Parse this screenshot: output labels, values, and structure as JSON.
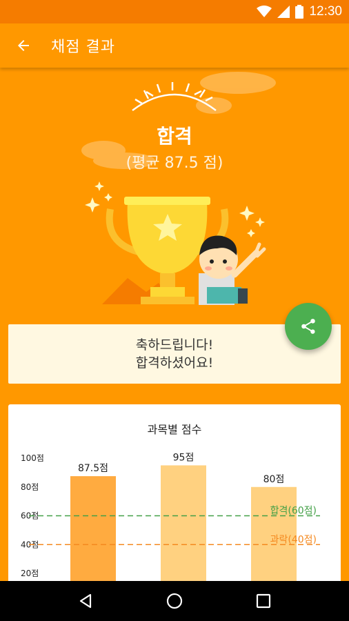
{
  "status_bar": {
    "time": "12:30"
  },
  "app_bar": {
    "title": "채점 결과"
  },
  "result": {
    "status": "합격",
    "average": "(평균 87.5 점)"
  },
  "congrats": {
    "line1": "축하드립니다!",
    "line2": "합격하셨어요!"
  },
  "icons": {
    "back": "arrow-back-icon",
    "share": "share-icon",
    "nav_back": "triangle-back-icon",
    "nav_home": "circle-home-icon",
    "nav_recent": "square-recents-icon"
  },
  "colors": {
    "primary": "#FF9800",
    "status_bar": "#F57C00",
    "fab": "#4CAF50",
    "pass_line": "#43A047",
    "fail_line": "#F4891F",
    "bar_first": "#FFAB40",
    "bar_other": "#FFD180"
  },
  "chart_data": {
    "type": "bar",
    "title": "과목별 점수",
    "categories": [
      "",
      "",
      ""
    ],
    "values": [
      87.5,
      95,
      80
    ],
    "value_labels": [
      "87.5점",
      "95점",
      "80점"
    ],
    "yticks": [
      "20점",
      "40점",
      "60점",
      "80점",
      "100점"
    ],
    "ytick_values": [
      20,
      40,
      60,
      80,
      100
    ],
    "ylim": [
      0,
      100
    ],
    "reference_lines": [
      {
        "label": "합격(60점)",
        "value": 60,
        "color": "#43A047"
      },
      {
        "label": "과락(40점)",
        "value": 40,
        "color": "#F4891F"
      }
    ]
  }
}
